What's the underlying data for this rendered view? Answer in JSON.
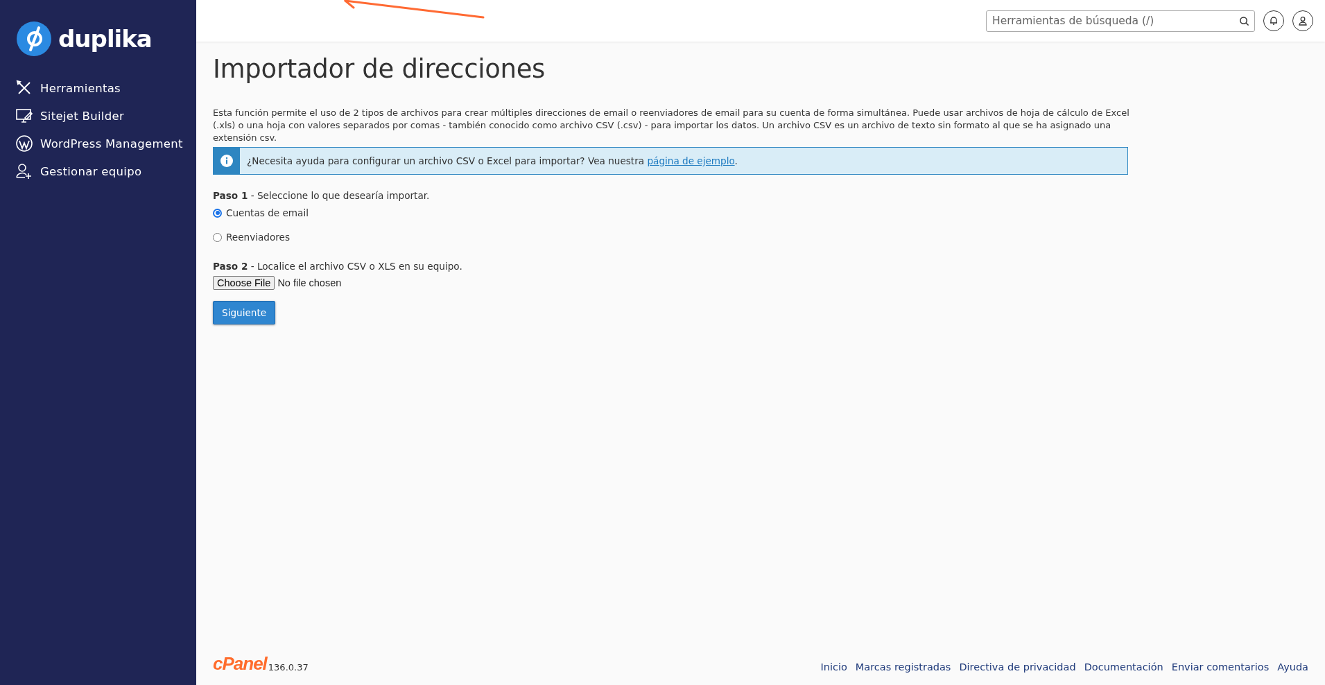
{
  "sidebar": {
    "logo": "duplika",
    "items": [
      {
        "label": "Herramientas"
      },
      {
        "label": "Sitejet Builder"
      },
      {
        "label": "WordPress Management"
      },
      {
        "label": "Gestionar equipo"
      }
    ]
  },
  "header": {
    "search": {
      "placeholder": "Herramientas de búsqueda (/)"
    }
  },
  "page": {
    "title": "Importador de direcciones",
    "description": "Esta función permite el uso de 2 tipos de archivos para crear múltiples direcciones de email o reenviadores de email para su cuenta de forma simultánea. Puede usar archivos de hoja de cálculo de Excel (.xls) o una hoja con valores separados por comas - también conocido como archivo CSV (.csv) - para importar los datos. Un archivo CSV es un archivo de texto sin formato al que se ha asignado una extensión csv.",
    "info": {
      "text": "¿Necesita ayuda para configurar un archivo CSV o Excel para importar? Vea nuestra ",
      "link": "página de ejemplo",
      "after": "."
    },
    "step1": "**Paso 1** - Seleccione lo que desearía importar.",
    "import_options": [
      {
        "label": "Cuentas de email",
        "selected": true
      },
      {
        "label": "Reenviadores",
        "selected": false
      }
    ],
    "step2": "**Paso 2** - Localice el archivo CSV o XLS en su equipo.",
    "file": {
      "button": "Choose File",
      "status": "No file chosen"
    },
    "submit": "Siguiente"
  },
  "footer": {
    "logo": "cPanel",
    "version": "136.0.37",
    "links": [
      "Inicio",
      "Marcas registradas",
      "Directiva de privacidad",
      "Documentación",
      "Enviar comentarios",
      "Ayuda"
    ]
  }
}
